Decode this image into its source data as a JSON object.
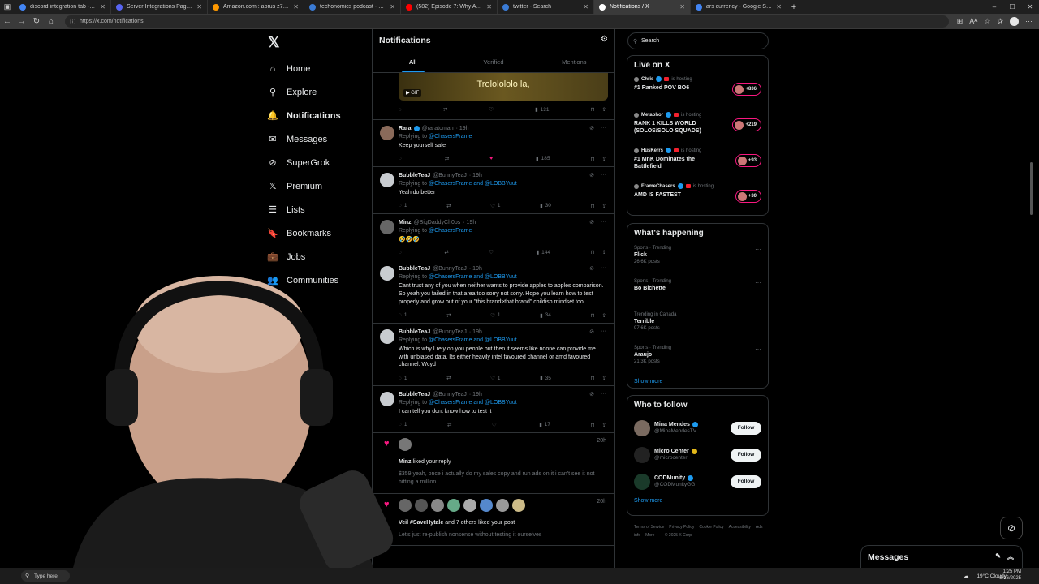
{
  "browser": {
    "tabs": [
      {
        "label": "discord integration tab - Google",
        "color": "#4285f4",
        "active": false
      },
      {
        "label": "Server Integrations Page - Disco",
        "color": "#5865f2",
        "active": false
      },
      {
        "label": "Amazon.com : aorus z790",
        "color": "#ff9900",
        "active": false
      },
      {
        "label": "techonomics podcast - Search",
        "color": "#3a7bd5",
        "active": false
      },
      {
        "label": "(582) Episode 7: Why All Tech",
        "color": "#ff0000",
        "active": false
      },
      {
        "label": "twitter - Search",
        "color": "#3a7bd5",
        "active": false
      },
      {
        "label": "Notifications / X",
        "color": "#000000",
        "active": true
      },
      {
        "label": "ars currency - Google Search",
        "color": "#4285f4",
        "active": false
      }
    ],
    "url": "https://x.com/notifications"
  },
  "nav": {
    "items": [
      {
        "label": "Home",
        "icon": "home-icon",
        "glyph": "⌂",
        "bold": false
      },
      {
        "label": "Explore",
        "icon": "search-icon",
        "glyph": "⚲",
        "bold": false
      },
      {
        "label": "Notifications",
        "icon": "bell-icon",
        "glyph": "🔔",
        "bold": true
      },
      {
        "label": "Messages",
        "icon": "mail-icon",
        "glyph": "✉",
        "bold": false
      },
      {
        "label": "SuperGrok",
        "icon": "grok-icon",
        "glyph": "⊘",
        "bold": false
      },
      {
        "label": "Premium",
        "icon": "x-premium-icon",
        "glyph": "𝕏",
        "bold": false
      },
      {
        "label": "Lists",
        "icon": "lists-icon",
        "glyph": "☰",
        "bold": false
      },
      {
        "label": "Bookmarks",
        "icon": "bookmark-icon",
        "glyph": "🔖",
        "bold": false
      },
      {
        "label": "Jobs",
        "icon": "briefcase-icon",
        "glyph": "💼",
        "bold": false
      },
      {
        "label": "Communities",
        "icon": "communities-icon",
        "glyph": "👥",
        "bold": false
      }
    ]
  },
  "feed": {
    "title": "Notifications",
    "tabs": [
      "All",
      "Verified",
      "Mentions"
    ],
    "gif_post": {
      "caption": "Trololololo la,",
      "badge": "GIF",
      "views": "131"
    },
    "replies": [
      {
        "name": "Rara",
        "handle": "@raratoman",
        "time": "· 19h",
        "replying_prefix": "Replying to",
        "replying_to": "@ChasersFrame",
        "text": "Keep yourself safe",
        "replies": "",
        "likes": "",
        "views": "185",
        "liked": true,
        "verified": true,
        "pfp": "#8a6a5a"
      },
      {
        "name": "BubbleTeaJ",
        "handle": "@BunnyTeaJ",
        "time": "· 19h",
        "replying_prefix": "Replying to",
        "replying_to": "@ChasersFrame and @LOBBYuut",
        "text": "Yeah do better",
        "replies": "1",
        "likes": "1",
        "views": "30",
        "liked": false,
        "verified": false,
        "pfp": "#c8ccd0"
      },
      {
        "name": "Minz",
        "handle": "@BigDaddyCh0ps",
        "time": "· 19h",
        "replying_prefix": "Replying to",
        "replying_to": "@ChasersFrame",
        "text": "🤣🤣🤣",
        "replies": "",
        "likes": "",
        "views": "144",
        "liked": false,
        "verified": false,
        "pfp": "#666"
      },
      {
        "name": "BubbleTeaJ",
        "handle": "@BunnyTeaJ",
        "time": "· 19h",
        "replying_prefix": "Replying to",
        "replying_to": "@ChasersFrame and @LOBBYuut",
        "text": "Cant trust any of you when neither wants to provide apples to apples comparison. So yeah you failed in that area too sorry not sorry. Hope you learn how to test properly and grow out of your \"this brand>that brand\" childish mindset too",
        "replies": "1",
        "likes": "1",
        "views": "34",
        "liked": false,
        "verified": false,
        "pfp": "#c8ccd0"
      },
      {
        "name": "BubbleTeaJ",
        "handle": "@BunnyTeaJ",
        "time": "· 19h",
        "replying_prefix": "Replying to",
        "replying_to": "@ChasersFrame and @LOBBYuut",
        "text": "Which is why I rely on you people but then it seems like noone can provide me with unbiased data. Its either heavily intel favoured channel or amd favoured channel. Wcyd",
        "replies": "1",
        "likes": "1",
        "views": "35",
        "liked": false,
        "verified": false,
        "pfp": "#c8ccd0"
      },
      {
        "name": "BubbleTeaJ",
        "handle": "@BunnyTeaJ",
        "time": "· 19h",
        "replying_prefix": "Replying to",
        "replying_to": "@ChasersFrame and @LOBBYuut",
        "text": "I can tell you dont know how to test it",
        "replies": "1",
        "likes": "",
        "views": "17",
        "liked": false,
        "verified": false,
        "pfp": "#c8ccd0"
      }
    ],
    "like_notifs": [
      {
        "time": "20h",
        "actor": "Minz",
        "action": "liked your reply",
        "quote": "$359 yeah, once i actually do my sales copy and run ads on it i can't see it not hitting a million"
      },
      {
        "time": "20h",
        "actor": "Veil #SaveHytale",
        "action": "and 7 others liked your post",
        "quote": "Let's just re-publish nonsense without testing it ourselves"
      }
    ]
  },
  "right": {
    "search_placeholder": "Search",
    "live": {
      "title": "Live on X",
      "hosting_label": "is hosting",
      "items": [
        {
          "host": "Chris",
          "title": "#1 Ranked POV BO6",
          "count": "+836"
        },
        {
          "host": "Metaphor",
          "title": "RANK 1 KILLS WORLD (SOLOS/SOLO SQUADS)",
          "count": "+219"
        },
        {
          "host": "HusKerrs",
          "title": "#1 MnK Dominates the Battlefield",
          "count": "+93"
        },
        {
          "host": "FrameChasers",
          "title": "AMD IS FASTEST",
          "count": "+30"
        }
      ]
    },
    "happening": {
      "title": "What's happening",
      "items": [
        {
          "meta": "Sports · Trending",
          "name": "Flick",
          "count": "26.6K posts"
        },
        {
          "meta": "Sports · Trending",
          "name": "Bo Bichette",
          "count": ""
        },
        {
          "meta": "Trending in Canada",
          "name": "Terrible",
          "count": "97.6K posts"
        },
        {
          "meta": "Sports · Trending",
          "name": "Araujo",
          "count": "21.3K posts"
        }
      ],
      "show_more": "Show more"
    },
    "follow": {
      "title": "Who to follow",
      "items": [
        {
          "name": "Mina Mendes",
          "handle": "@MinaMendesTV",
          "button": "Follow",
          "badge": "blue",
          "pfp": "#7a6a60"
        },
        {
          "name": "Micro Center",
          "handle": "@microcenter",
          "button": "Follow",
          "badge": "gold",
          "pfp": "#222"
        },
        {
          "name": "CODMunity",
          "handle": "@CODMunityGG",
          "button": "Follow",
          "badge": "blue",
          "pfp": "#1a3a2a"
        }
      ],
      "show_more": "Show more"
    },
    "footer": [
      "Terms of Service",
      "Privacy Policy",
      "Cookie Policy",
      "Accessibility",
      "Ads info",
      "More ···",
      "© 2025 X Corp."
    ]
  },
  "messages_bar": {
    "label": "Messages"
  },
  "taskbar": {
    "search": "Type here",
    "weather": "19°C Cloudy",
    "time": "1:25 PM",
    "date": "8/16/2025"
  }
}
